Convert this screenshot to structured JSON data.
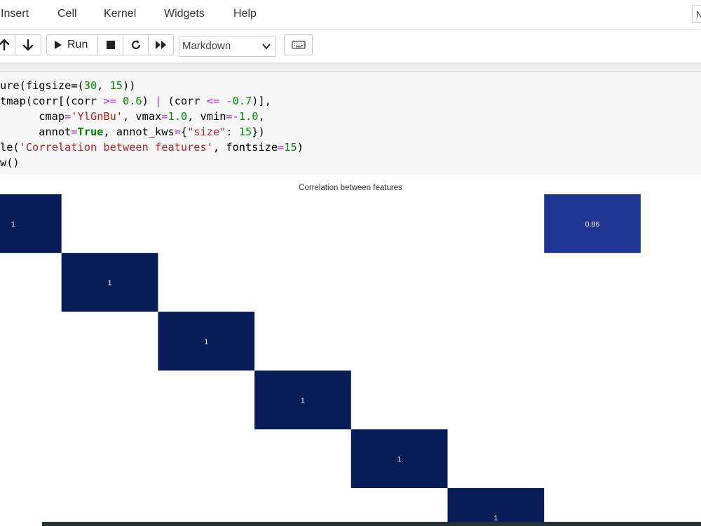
{
  "menubar": {
    "items": [
      "Insert",
      "Cell",
      "Kernel",
      "Widgets",
      "Help"
    ],
    "kernel_indicator": "N"
  },
  "toolbar": {
    "run_label": "Run",
    "cell_type": "Markdown",
    "icons": [
      "arrow-up-icon",
      "arrow-down-icon",
      "play-icon",
      "stop-icon",
      "restart-icon",
      "fast-forward-icon",
      "keyboard-icon"
    ]
  },
  "code": {
    "lines": [
      "ure(figsize=(30, 15))",
      "tmap(corr[(corr >= 0.6) | (corr <= -0.7)],",
      "      cmap='YlGnBu', vmax=1.0, vmin=-1.0,",
      "      annot=True, annot_kws={\"size\": 15})",
      "le('Correlation between features', fontsize=15)",
      "w()"
    ]
  },
  "output": {
    "plot_title": "Correlation between features"
  },
  "chart_data": {
    "type": "heatmap",
    "title": "Correlation between features",
    "colormap": "YlGnBu",
    "vmin": -1.0,
    "vmax": 1.0,
    "cells": [
      {
        "row": 0,
        "col": 0,
        "value": 1
      },
      {
        "row": 0,
        "col": 6,
        "value": 0.86
      },
      {
        "row": 1,
        "col": 1,
        "value": 1
      },
      {
        "row": 2,
        "col": 2,
        "value": 1
      },
      {
        "row": 3,
        "col": 3,
        "value": 1
      },
      {
        "row": 4,
        "col": 4,
        "value": 1
      },
      {
        "row": 5,
        "col": 5,
        "value": 1
      }
    ],
    "colors": {
      "one": "#081d58",
      "mid": "#1e3591"
    }
  }
}
